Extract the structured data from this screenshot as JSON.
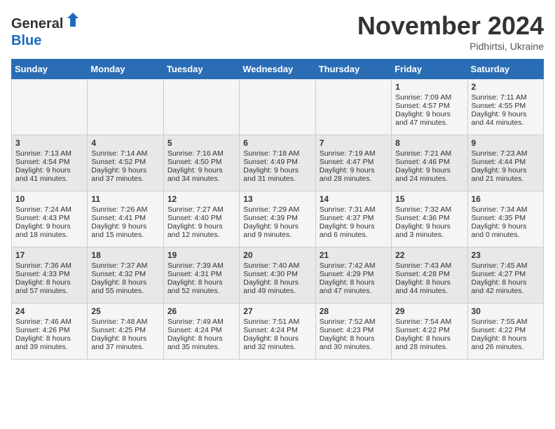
{
  "header": {
    "logo_line1": "General",
    "logo_line2": "Blue",
    "month": "November 2024",
    "location": "Pidhirtsi, Ukraine"
  },
  "weekdays": [
    "Sunday",
    "Monday",
    "Tuesday",
    "Wednesday",
    "Thursday",
    "Friday",
    "Saturday"
  ],
  "weeks": [
    [
      {
        "day": "",
        "text": ""
      },
      {
        "day": "",
        "text": ""
      },
      {
        "day": "",
        "text": ""
      },
      {
        "day": "",
        "text": ""
      },
      {
        "day": "",
        "text": ""
      },
      {
        "day": "1",
        "text": "Sunrise: 7:09 AM\nSunset: 4:57 PM\nDaylight: 9 hours and 47 minutes."
      },
      {
        "day": "2",
        "text": "Sunrise: 7:11 AM\nSunset: 4:55 PM\nDaylight: 9 hours and 44 minutes."
      }
    ],
    [
      {
        "day": "3",
        "text": "Sunrise: 7:13 AM\nSunset: 4:54 PM\nDaylight: 9 hours and 41 minutes."
      },
      {
        "day": "4",
        "text": "Sunrise: 7:14 AM\nSunset: 4:52 PM\nDaylight: 9 hours and 37 minutes."
      },
      {
        "day": "5",
        "text": "Sunrise: 7:16 AM\nSunset: 4:50 PM\nDaylight: 9 hours and 34 minutes."
      },
      {
        "day": "6",
        "text": "Sunrise: 7:18 AM\nSunset: 4:49 PM\nDaylight: 9 hours and 31 minutes."
      },
      {
        "day": "7",
        "text": "Sunrise: 7:19 AM\nSunset: 4:47 PM\nDaylight: 9 hours and 28 minutes."
      },
      {
        "day": "8",
        "text": "Sunrise: 7:21 AM\nSunset: 4:46 PM\nDaylight: 9 hours and 24 minutes."
      },
      {
        "day": "9",
        "text": "Sunrise: 7:23 AM\nSunset: 4:44 PM\nDaylight: 9 hours and 21 minutes."
      }
    ],
    [
      {
        "day": "10",
        "text": "Sunrise: 7:24 AM\nSunset: 4:43 PM\nDaylight: 9 hours and 18 minutes."
      },
      {
        "day": "11",
        "text": "Sunrise: 7:26 AM\nSunset: 4:41 PM\nDaylight: 9 hours and 15 minutes."
      },
      {
        "day": "12",
        "text": "Sunrise: 7:27 AM\nSunset: 4:40 PM\nDaylight: 9 hours and 12 minutes."
      },
      {
        "day": "13",
        "text": "Sunrise: 7:29 AM\nSunset: 4:39 PM\nDaylight: 9 hours and 9 minutes."
      },
      {
        "day": "14",
        "text": "Sunrise: 7:31 AM\nSunset: 4:37 PM\nDaylight: 9 hours and 6 minutes."
      },
      {
        "day": "15",
        "text": "Sunrise: 7:32 AM\nSunset: 4:36 PM\nDaylight: 9 hours and 3 minutes."
      },
      {
        "day": "16",
        "text": "Sunrise: 7:34 AM\nSunset: 4:35 PM\nDaylight: 9 hours and 0 minutes."
      }
    ],
    [
      {
        "day": "17",
        "text": "Sunrise: 7:36 AM\nSunset: 4:33 PM\nDaylight: 8 hours and 57 minutes."
      },
      {
        "day": "18",
        "text": "Sunrise: 7:37 AM\nSunset: 4:32 PM\nDaylight: 8 hours and 55 minutes."
      },
      {
        "day": "19",
        "text": "Sunrise: 7:39 AM\nSunset: 4:31 PM\nDaylight: 8 hours and 52 minutes."
      },
      {
        "day": "20",
        "text": "Sunrise: 7:40 AM\nSunset: 4:30 PM\nDaylight: 8 hours and 49 minutes."
      },
      {
        "day": "21",
        "text": "Sunrise: 7:42 AM\nSunset: 4:29 PM\nDaylight: 8 hours and 47 minutes."
      },
      {
        "day": "22",
        "text": "Sunrise: 7:43 AM\nSunset: 4:28 PM\nDaylight: 8 hours and 44 minutes."
      },
      {
        "day": "23",
        "text": "Sunrise: 7:45 AM\nSunset: 4:27 PM\nDaylight: 8 hours and 42 minutes."
      }
    ],
    [
      {
        "day": "24",
        "text": "Sunrise: 7:46 AM\nSunset: 4:26 PM\nDaylight: 8 hours and 39 minutes."
      },
      {
        "day": "25",
        "text": "Sunrise: 7:48 AM\nSunset: 4:25 PM\nDaylight: 8 hours and 37 minutes."
      },
      {
        "day": "26",
        "text": "Sunrise: 7:49 AM\nSunset: 4:24 PM\nDaylight: 8 hours and 35 minutes."
      },
      {
        "day": "27",
        "text": "Sunrise: 7:51 AM\nSunset: 4:24 PM\nDaylight: 8 hours and 32 minutes."
      },
      {
        "day": "28",
        "text": "Sunrise: 7:52 AM\nSunset: 4:23 PM\nDaylight: 8 hours and 30 minutes."
      },
      {
        "day": "29",
        "text": "Sunrise: 7:54 AM\nSunset: 4:22 PM\nDaylight: 8 hours and 28 minutes."
      },
      {
        "day": "30",
        "text": "Sunrise: 7:55 AM\nSunset: 4:22 PM\nDaylight: 8 hours and 26 minutes."
      }
    ]
  ]
}
